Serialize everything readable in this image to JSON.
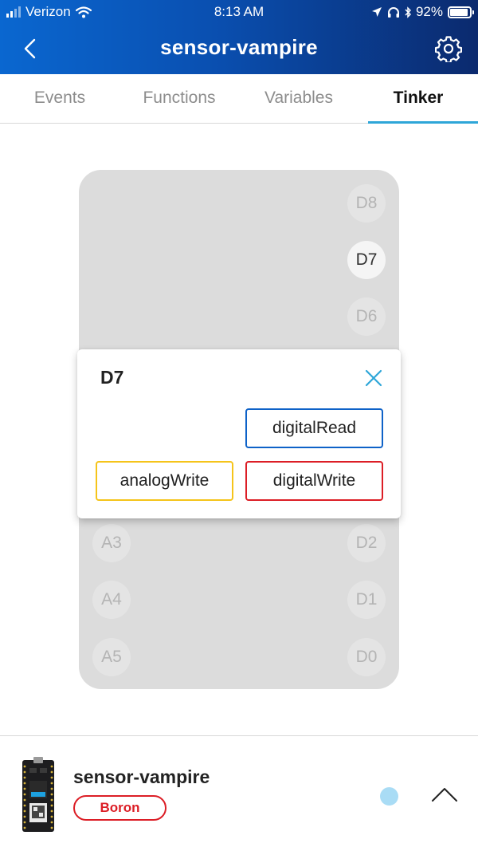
{
  "status_bar": {
    "carrier": "Verizon",
    "time": "8:13 AM",
    "battery": "92%",
    "battery_level": 0.92
  },
  "header": {
    "title": "sensor-vampire"
  },
  "tabs": [
    {
      "label": "Events",
      "active": false
    },
    {
      "label": "Functions",
      "active": false
    },
    {
      "label": "Variables",
      "active": false
    },
    {
      "label": "Tinker",
      "active": true
    }
  ],
  "board": {
    "pins_right": [
      "D8",
      "D7",
      "D6",
      "D2",
      "D1",
      "D0"
    ],
    "pins_left": [
      "A3",
      "A4",
      "A5"
    ],
    "selected_pin": "D7"
  },
  "popup": {
    "title": "D7",
    "buttons": {
      "digital_read": "digitalRead",
      "analog_write": "analogWrite",
      "digital_write": "digitalWrite"
    }
  },
  "footer": {
    "device_name": "sensor-vampire",
    "device_type": "Boron"
  },
  "colors": {
    "header_start": "#0a67d0",
    "header_end": "#0b2a6e",
    "tab_indicator": "#2ea6d8",
    "digital_read_border": "#0e62c8",
    "analog_write_border": "#f5c41a",
    "digital_write_border": "#dc1e26",
    "badge": "#dc1e26",
    "status_dot": "#a9dcf5"
  }
}
